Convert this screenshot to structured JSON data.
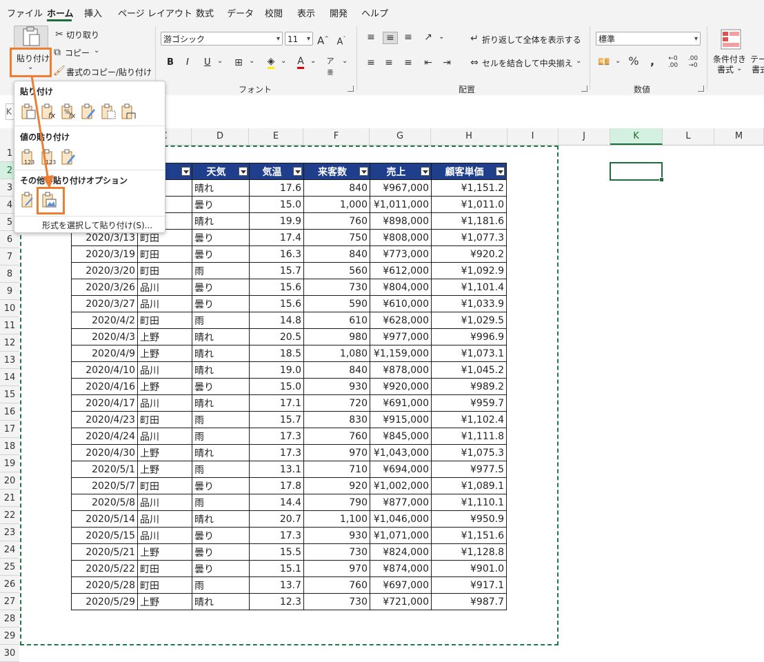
{
  "menubar": {
    "items": [
      "ファイル",
      "ホーム",
      "挿入",
      "ページ レイアウト",
      "数式",
      "データ",
      "校閲",
      "表示",
      "開発",
      "ヘルプ"
    ],
    "active": "ホーム"
  },
  "clipboard": {
    "paste_label": "貼り付け",
    "cut_label": "切り取り",
    "copy_label": "コピー",
    "format_painter_label": "書式のコピー/貼り付け"
  },
  "font": {
    "font_name": "游ゴシック",
    "font_size": "11",
    "bold": "B",
    "italic": "I",
    "underline": "U",
    "group_label": "フォント"
  },
  "alignment": {
    "wrap_text_label": "折り返して全体を表示する",
    "merge_center_label": "セルを結合して中央揃え",
    "group_label": "配置"
  },
  "number": {
    "format_value": "標準",
    "group_label": "数値"
  },
  "styles": {
    "conditional_label_1": "条件付き",
    "conditional_label_2": "書式",
    "table_label_1": "テー",
    "table_label_2": "書式"
  },
  "paste_menu": {
    "section_paste": "貼り付け",
    "section_values": "値の貼り付け",
    "section_other": "その他の貼り付けオプション",
    "paste_special": "形式を選択して貼り付け(S)..."
  },
  "namebox_value": "K",
  "columns": [
    "C",
    "D",
    "E",
    "F",
    "G",
    "H",
    "I",
    "J",
    "K",
    "L",
    "M"
  ],
  "selected_column": "K",
  "rows": [
    "1",
    "2",
    "3",
    "4",
    "5",
    "6",
    "7",
    "8",
    "9",
    "10",
    "11",
    "12",
    "13",
    "14",
    "15",
    "16",
    "17",
    "18",
    "19",
    "20",
    "21",
    "22",
    "23",
    "24",
    "25",
    "26",
    "27",
    "28",
    "29",
    "30"
  ],
  "selected_row": "2",
  "table": {
    "headers": [
      "場",
      "天気",
      "気温",
      "来客数",
      "売上",
      "顧客単価"
    ],
    "rows": [
      [
        "",
        "",
        "晴れ",
        "17.6",
        "840",
        "¥967,000",
        "¥1,151.2"
      ],
      [
        "",
        "",
        "曇り",
        "15.0",
        "1,000",
        "¥1,011,000",
        "¥1,011.0"
      ],
      [
        "",
        "",
        "晴れ",
        "19.9",
        "760",
        "¥898,000",
        "¥1,181.6"
      ],
      [
        "2020/3/13",
        "町田",
        "曇り",
        "17.4",
        "750",
        "¥808,000",
        "¥1,077.3"
      ],
      [
        "2020/3/19",
        "町田",
        "曇り",
        "16.3",
        "840",
        "¥773,000",
        "¥920.2"
      ],
      [
        "2020/3/20",
        "町田",
        "雨",
        "15.7",
        "560",
        "¥612,000",
        "¥1,092.9"
      ],
      [
        "2020/3/26",
        "品川",
        "曇り",
        "15.6",
        "730",
        "¥804,000",
        "¥1,101.4"
      ],
      [
        "2020/3/27",
        "品川",
        "曇り",
        "15.6",
        "590",
        "¥610,000",
        "¥1,033.9"
      ],
      [
        "2020/4/2",
        "町田",
        "雨",
        "14.8",
        "610",
        "¥628,000",
        "¥1,029.5"
      ],
      [
        "2020/4/3",
        "上野",
        "晴れ",
        "20.5",
        "980",
        "¥977,000",
        "¥996.9"
      ],
      [
        "2020/4/9",
        "上野",
        "晴れ",
        "18.5",
        "1,080",
        "¥1,159,000",
        "¥1,073.1"
      ],
      [
        "2020/4/10",
        "品川",
        "晴れ",
        "19.0",
        "840",
        "¥878,000",
        "¥1,045.2"
      ],
      [
        "2020/4/16",
        "上野",
        "曇り",
        "15.0",
        "930",
        "¥920,000",
        "¥989.2"
      ],
      [
        "2020/4/17",
        "品川",
        "晴れ",
        "17.1",
        "720",
        "¥691,000",
        "¥959.7"
      ],
      [
        "2020/4/23",
        "町田",
        "雨",
        "15.7",
        "830",
        "¥915,000",
        "¥1,102.4"
      ],
      [
        "2020/4/24",
        "品川",
        "雨",
        "17.3",
        "760",
        "¥845,000",
        "¥1,111.8"
      ],
      [
        "2020/4/30",
        "上野",
        "晴れ",
        "17.3",
        "970",
        "¥1,043,000",
        "¥1,075.3"
      ],
      [
        "2020/5/1",
        "上野",
        "雨",
        "13.1",
        "710",
        "¥694,000",
        "¥977.5"
      ],
      [
        "2020/5/7",
        "町田",
        "曇り",
        "17.8",
        "920",
        "¥1,002,000",
        "¥1,089.1"
      ],
      [
        "2020/5/8",
        "品川",
        "雨",
        "14.4",
        "790",
        "¥877,000",
        "¥1,110.1"
      ],
      [
        "2020/5/14",
        "品川",
        "晴れ",
        "20.7",
        "1,100",
        "¥1,046,000",
        "¥950.9"
      ],
      [
        "2020/5/15",
        "品川",
        "曇り",
        "17.3",
        "930",
        "¥1,071,000",
        "¥1,151.6"
      ],
      [
        "2020/5/21",
        "上野",
        "曇り",
        "15.5",
        "730",
        "¥824,000",
        "¥1,128.8"
      ],
      [
        "2020/5/22",
        "町田",
        "曇り",
        "15.1",
        "970",
        "¥874,000",
        "¥901.0"
      ],
      [
        "2020/5/28",
        "町田",
        "雨",
        "13.7",
        "760",
        "¥697,000",
        "¥917.1"
      ],
      [
        "2020/5/29",
        "上野",
        "晴れ",
        "12.3",
        "730",
        "¥721,000",
        "¥987.7"
      ]
    ]
  },
  "colors": {
    "accent": "#1e6b3b",
    "table_header": "#1f3f8c",
    "highlight": "#ed7d31"
  }
}
